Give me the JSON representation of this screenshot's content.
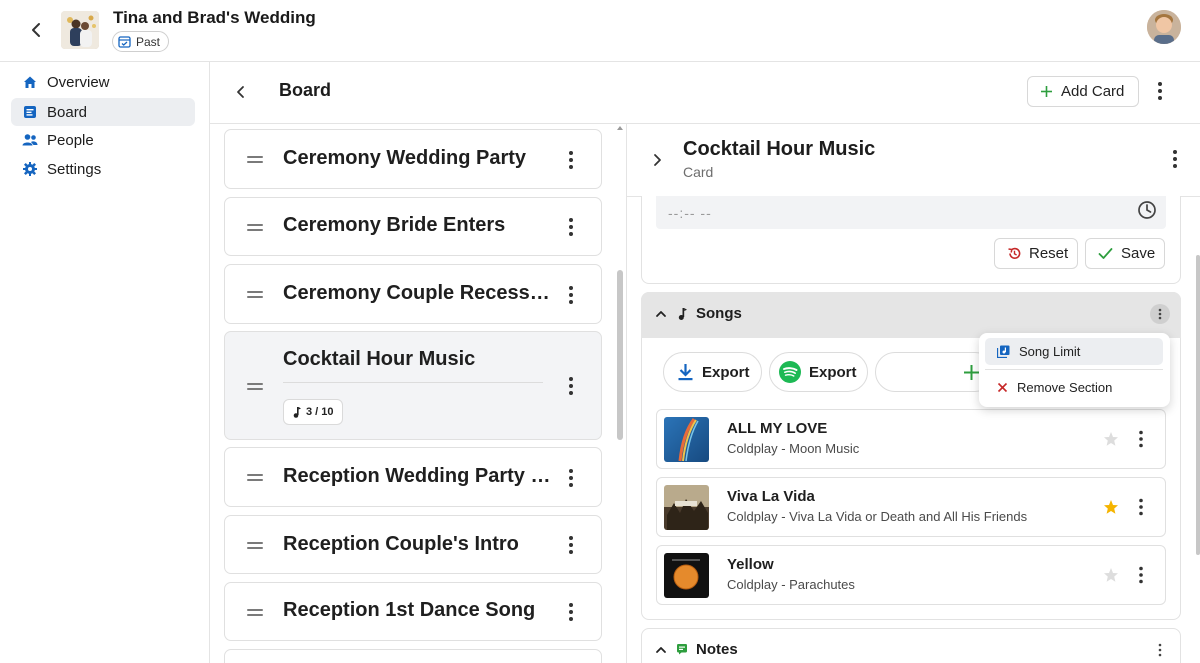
{
  "header": {
    "event_title": "Tina and Brad's Wedding",
    "status_badge": "Past",
    "back_icon": "chevron-left-icon",
    "avatar_icon": "user-avatar"
  },
  "sidebar": {
    "items": [
      {
        "label": "Overview",
        "icon": "home-icon",
        "active": false
      },
      {
        "label": "Board",
        "icon": "board-icon",
        "active": true
      },
      {
        "label": "People",
        "icon": "people-icon",
        "active": false
      },
      {
        "label": "Settings",
        "icon": "gear-icon",
        "active": false
      }
    ]
  },
  "board": {
    "title": "Board",
    "add_card_label": "Add Card",
    "cards": [
      {
        "title": "Ceremony Wedding Party"
      },
      {
        "title": "Ceremony Bride Enters"
      },
      {
        "title": "Ceremony Couple Recessional"
      },
      {
        "title": "Cocktail Hour Music",
        "count": "3 / 10",
        "selected": true
      },
      {
        "title": "Reception Wedding Party Intro"
      },
      {
        "title": "Reception Couple's Intro"
      },
      {
        "title": "Reception 1st Dance Song"
      }
    ]
  },
  "detail": {
    "title": "Cocktail Hour Music",
    "subtitle": "Card",
    "time_placeholder": "--:-- --",
    "reset_label": "Reset",
    "save_label": "Save",
    "songs": {
      "title": "Songs",
      "export_download_label": "Export",
      "export_spotify_label": "Export",
      "list": [
        {
          "title": "ALL MY LOVE",
          "subtitle": "Coldplay - Moon Music",
          "starred": false
        },
        {
          "title": "Viva La Vida",
          "subtitle": "Coldplay - Viva La Vida or Death and All His Friends",
          "starred": true
        },
        {
          "title": "Yellow",
          "subtitle": "Coldplay - Parachutes",
          "starred": false
        }
      ]
    },
    "notes": {
      "title": "Notes"
    }
  },
  "menu": {
    "song_limit_label": "Song Limit",
    "remove_section_label": "Remove Section"
  },
  "colors": {
    "accent_blue": "#1565c0",
    "spotify_green": "#1db954",
    "add_green": "#2e9e3e",
    "star_gold": "#f5b400",
    "reset_red": "#c62828"
  }
}
